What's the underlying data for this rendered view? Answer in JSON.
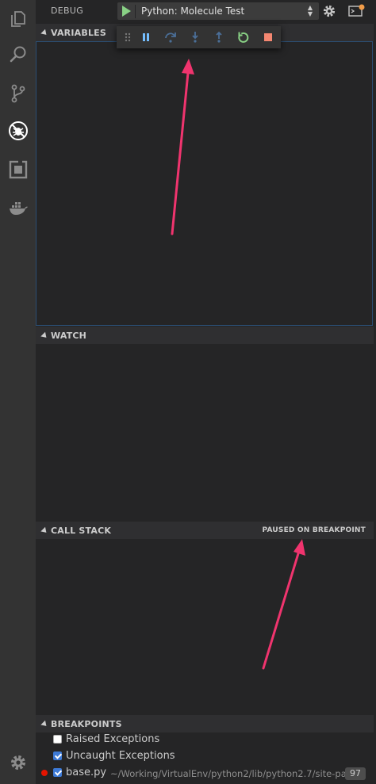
{
  "debug": {
    "title": "DEBUG",
    "configuration": "Python: Molecule Test"
  },
  "activity_bar": {
    "items": [
      "files-icon",
      "search-icon",
      "source-control-icon",
      "debug-icon",
      "extensions-icon",
      "docker-icon"
    ],
    "settings": "gear-icon"
  },
  "sections": {
    "variables": "VARIABLES",
    "watch": "WATCH",
    "call_stack": "CALL STACK",
    "call_stack_status": "PAUSED ON BREAKPOINT",
    "breakpoints": "BREAKPOINTS"
  },
  "toolbar": {
    "buttons": [
      "drag-handle-icon",
      "pause-icon",
      "step-over-icon",
      "step-into-icon",
      "step-out-icon",
      "restart-icon",
      "stop-icon"
    ]
  },
  "breakpoints": {
    "items": [
      {
        "label": "Raised Exceptions",
        "checked": false
      },
      {
        "label": "Uncaught Exceptions",
        "checked": true
      },
      {
        "label": "base.py",
        "checked": true,
        "path": "~/Working/VirtualEnv/python2/lib/python2.7/site-pac...",
        "line": "97"
      }
    ]
  },
  "colors": {
    "accent_blue": "#3d7ad6",
    "breakpoint_red": "#e51400",
    "start_green": "#89d185",
    "stop_red": "#f48771",
    "annotation_pink": "#f0346e"
  }
}
